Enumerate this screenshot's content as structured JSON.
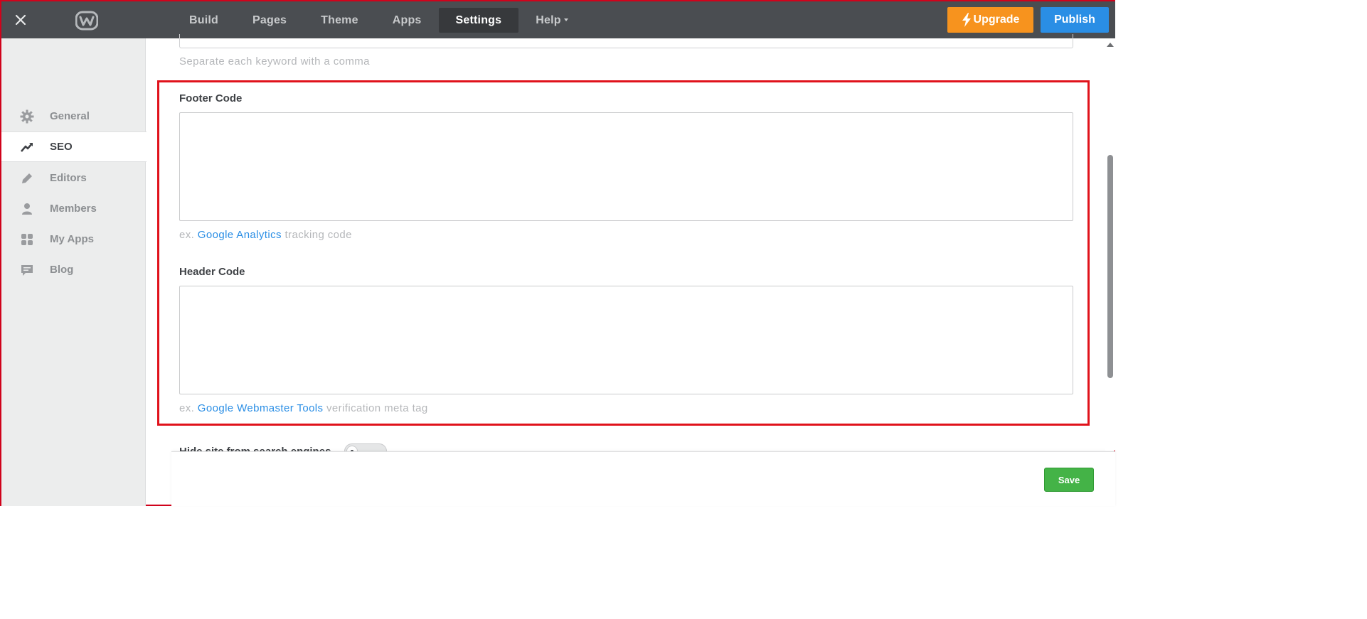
{
  "topbar": {
    "close_icon": "close-icon",
    "logo_icon": "weebly-logo-icon",
    "nav": [
      {
        "label": "Build",
        "active": false
      },
      {
        "label": "Pages",
        "active": false
      },
      {
        "label": "Theme",
        "active": false
      },
      {
        "label": "Apps",
        "active": false
      },
      {
        "label": "Settings",
        "active": true
      },
      {
        "label": "Help",
        "active": false,
        "dropdown": true
      }
    ],
    "upgrade_label": "Upgrade",
    "upgrade_icon": "lightning-icon",
    "publish_label": "Publish",
    "colors": {
      "bar": "#4a4d51",
      "upgrade": "#f7931e",
      "publish": "#2a8ee5"
    }
  },
  "sidebar": {
    "items": [
      {
        "label": "General",
        "icon": "gear-icon",
        "active": false
      },
      {
        "label": "SEO",
        "icon": "trending-up-icon",
        "active": true
      },
      {
        "label": "Editors",
        "icon": "pencil-icon",
        "active": false
      },
      {
        "label": "Members",
        "icon": "person-icon",
        "active": false
      },
      {
        "label": "My Apps",
        "icon": "apps-grid-icon",
        "active": false
      },
      {
        "label": "Blog",
        "icon": "comment-icon",
        "active": false
      }
    ]
  },
  "main": {
    "keywords_hint": "Separate each keyword with a comma",
    "footer": {
      "label": "Footer Code",
      "value": "",
      "hint_prefix": "ex. ",
      "hint_link": "Google Analytics",
      "hint_suffix": " tracking code"
    },
    "header": {
      "label": "Header Code",
      "value": "",
      "hint_prefix": "ex. ",
      "hint_link": "Google Webmaster Tools",
      "hint_suffix": " verification meta tag"
    },
    "hide_site_label": "Hide site from search engines",
    "hide_site_enabled": false
  },
  "save_label": "Save",
  "colors": {
    "highlight": "#e0121b",
    "save": "#44b347",
    "link": "#2a8ee5"
  }
}
